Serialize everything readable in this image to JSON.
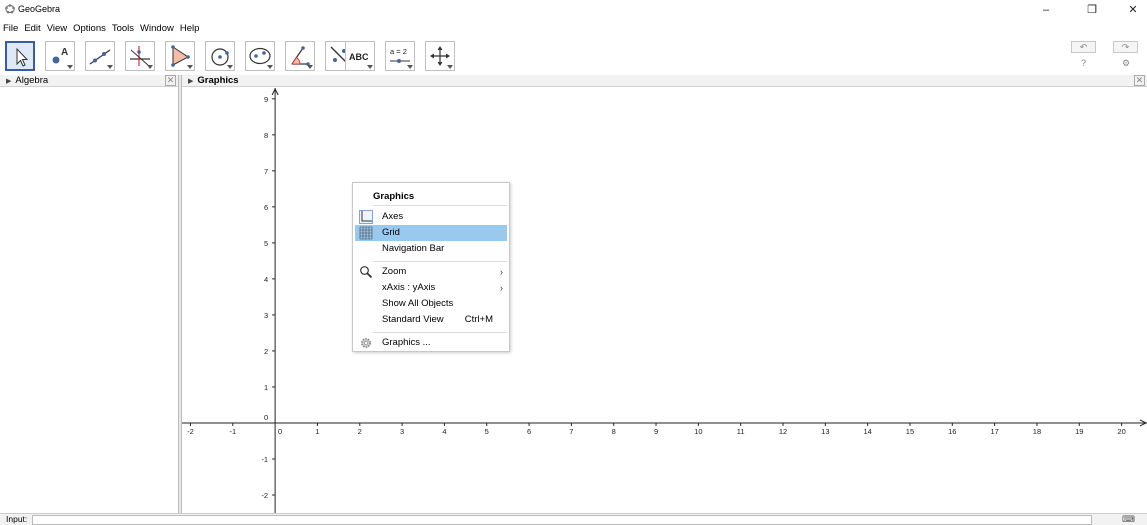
{
  "app": {
    "title": "GeoGebra"
  },
  "window_controls": {
    "minimize": "–",
    "restore": "❐",
    "close": "✕"
  },
  "menu": [
    "File",
    "Edit",
    "View",
    "Options",
    "Tools",
    "Window",
    "Help"
  ],
  "toolbar": {
    "tools": [
      {
        "name": "move-tool",
        "icon": "cursor-icon"
      },
      {
        "name": "point-tool",
        "icon": "point-icon"
      },
      {
        "name": "line-tool",
        "icon": "line-icon"
      },
      {
        "name": "perpendicular-tool",
        "icon": "perpendicular-icon"
      },
      {
        "name": "polygon-tool",
        "icon": "polygon-icon"
      },
      {
        "name": "circle-tool",
        "icon": "circle-icon"
      },
      {
        "name": "ellipse-tool",
        "icon": "ellipse-icon"
      },
      {
        "name": "angle-tool",
        "icon": "angle-icon"
      },
      {
        "name": "reflect-tool",
        "icon": "reflect-icon"
      },
      {
        "name": "text-tool",
        "icon": "text-icon",
        "label": "ABC"
      },
      {
        "name": "slider-tool",
        "icon": "slider-icon",
        "label": "a = 2"
      },
      {
        "name": "move-graphics-tool",
        "icon": "move-graphics-icon"
      }
    ],
    "undo": "↶",
    "redo": "↷",
    "help": "?",
    "settings": "⚙"
  },
  "panels": {
    "algebra": {
      "title": "Algebra"
    },
    "graphics": {
      "title": "Graphics"
    }
  },
  "graphics": {
    "x_ticks": [
      -2,
      -1,
      0,
      1,
      2,
      3,
      4,
      5,
      6,
      7,
      8,
      9,
      10,
      11,
      12,
      13,
      14,
      15,
      16,
      17,
      18,
      19,
      20
    ],
    "y_ticks": [
      -2,
      -1,
      0,
      1,
      2,
      3,
      4,
      5,
      6,
      7,
      8,
      9
    ],
    "x_range": [
      -2.2,
      20.6
    ],
    "y_range": [
      -2.5,
      9.3
    ]
  },
  "context_menu": {
    "title": "Graphics",
    "items": [
      {
        "label": "Axes",
        "icon": "axes-icon"
      },
      {
        "label": "Grid",
        "icon": "grid-icon",
        "selected": true
      },
      {
        "label": "Navigation Bar"
      },
      {
        "label": "Zoom",
        "icon": "zoom-icon",
        "submenu": "›"
      },
      {
        "label": "xAxis : yAxis",
        "submenu": "›"
      },
      {
        "label": "Show All Objects"
      },
      {
        "label": "Standard View",
        "shortcut": "Ctrl+M"
      },
      {
        "label": "Graphics ...",
        "icon": "gear-icon"
      }
    ]
  },
  "input_bar": {
    "label": "Input:",
    "value": "",
    "keyboard": "⌨"
  }
}
